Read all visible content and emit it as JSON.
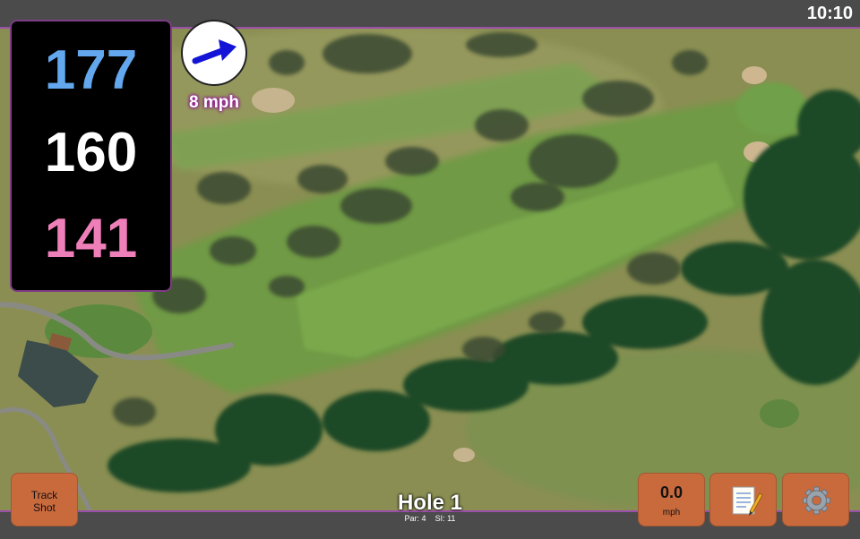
{
  "status_bar": {
    "time": "10:10"
  },
  "distances": {
    "back": "177",
    "middle": "160",
    "front": "141"
  },
  "wind": {
    "speed_label": "8 mph",
    "direction": "arrow-right-up"
  },
  "hole": {
    "title": "Hole 1",
    "par": "Par: 4",
    "si": "SI: 11"
  },
  "buttons": {
    "track_shot": [
      "Track",
      "Shot"
    ],
    "speed_value": "0.0",
    "speed_unit": "mph",
    "notes_icon": "memo-icon",
    "settings_icon": "gear-icon"
  },
  "colors": {
    "accent_border": "#9a4fa8",
    "back_distance": "#63a8ef",
    "middle_distance": "#ffffff",
    "front_distance": "#ef7fb9",
    "button": "#c96a3d"
  }
}
